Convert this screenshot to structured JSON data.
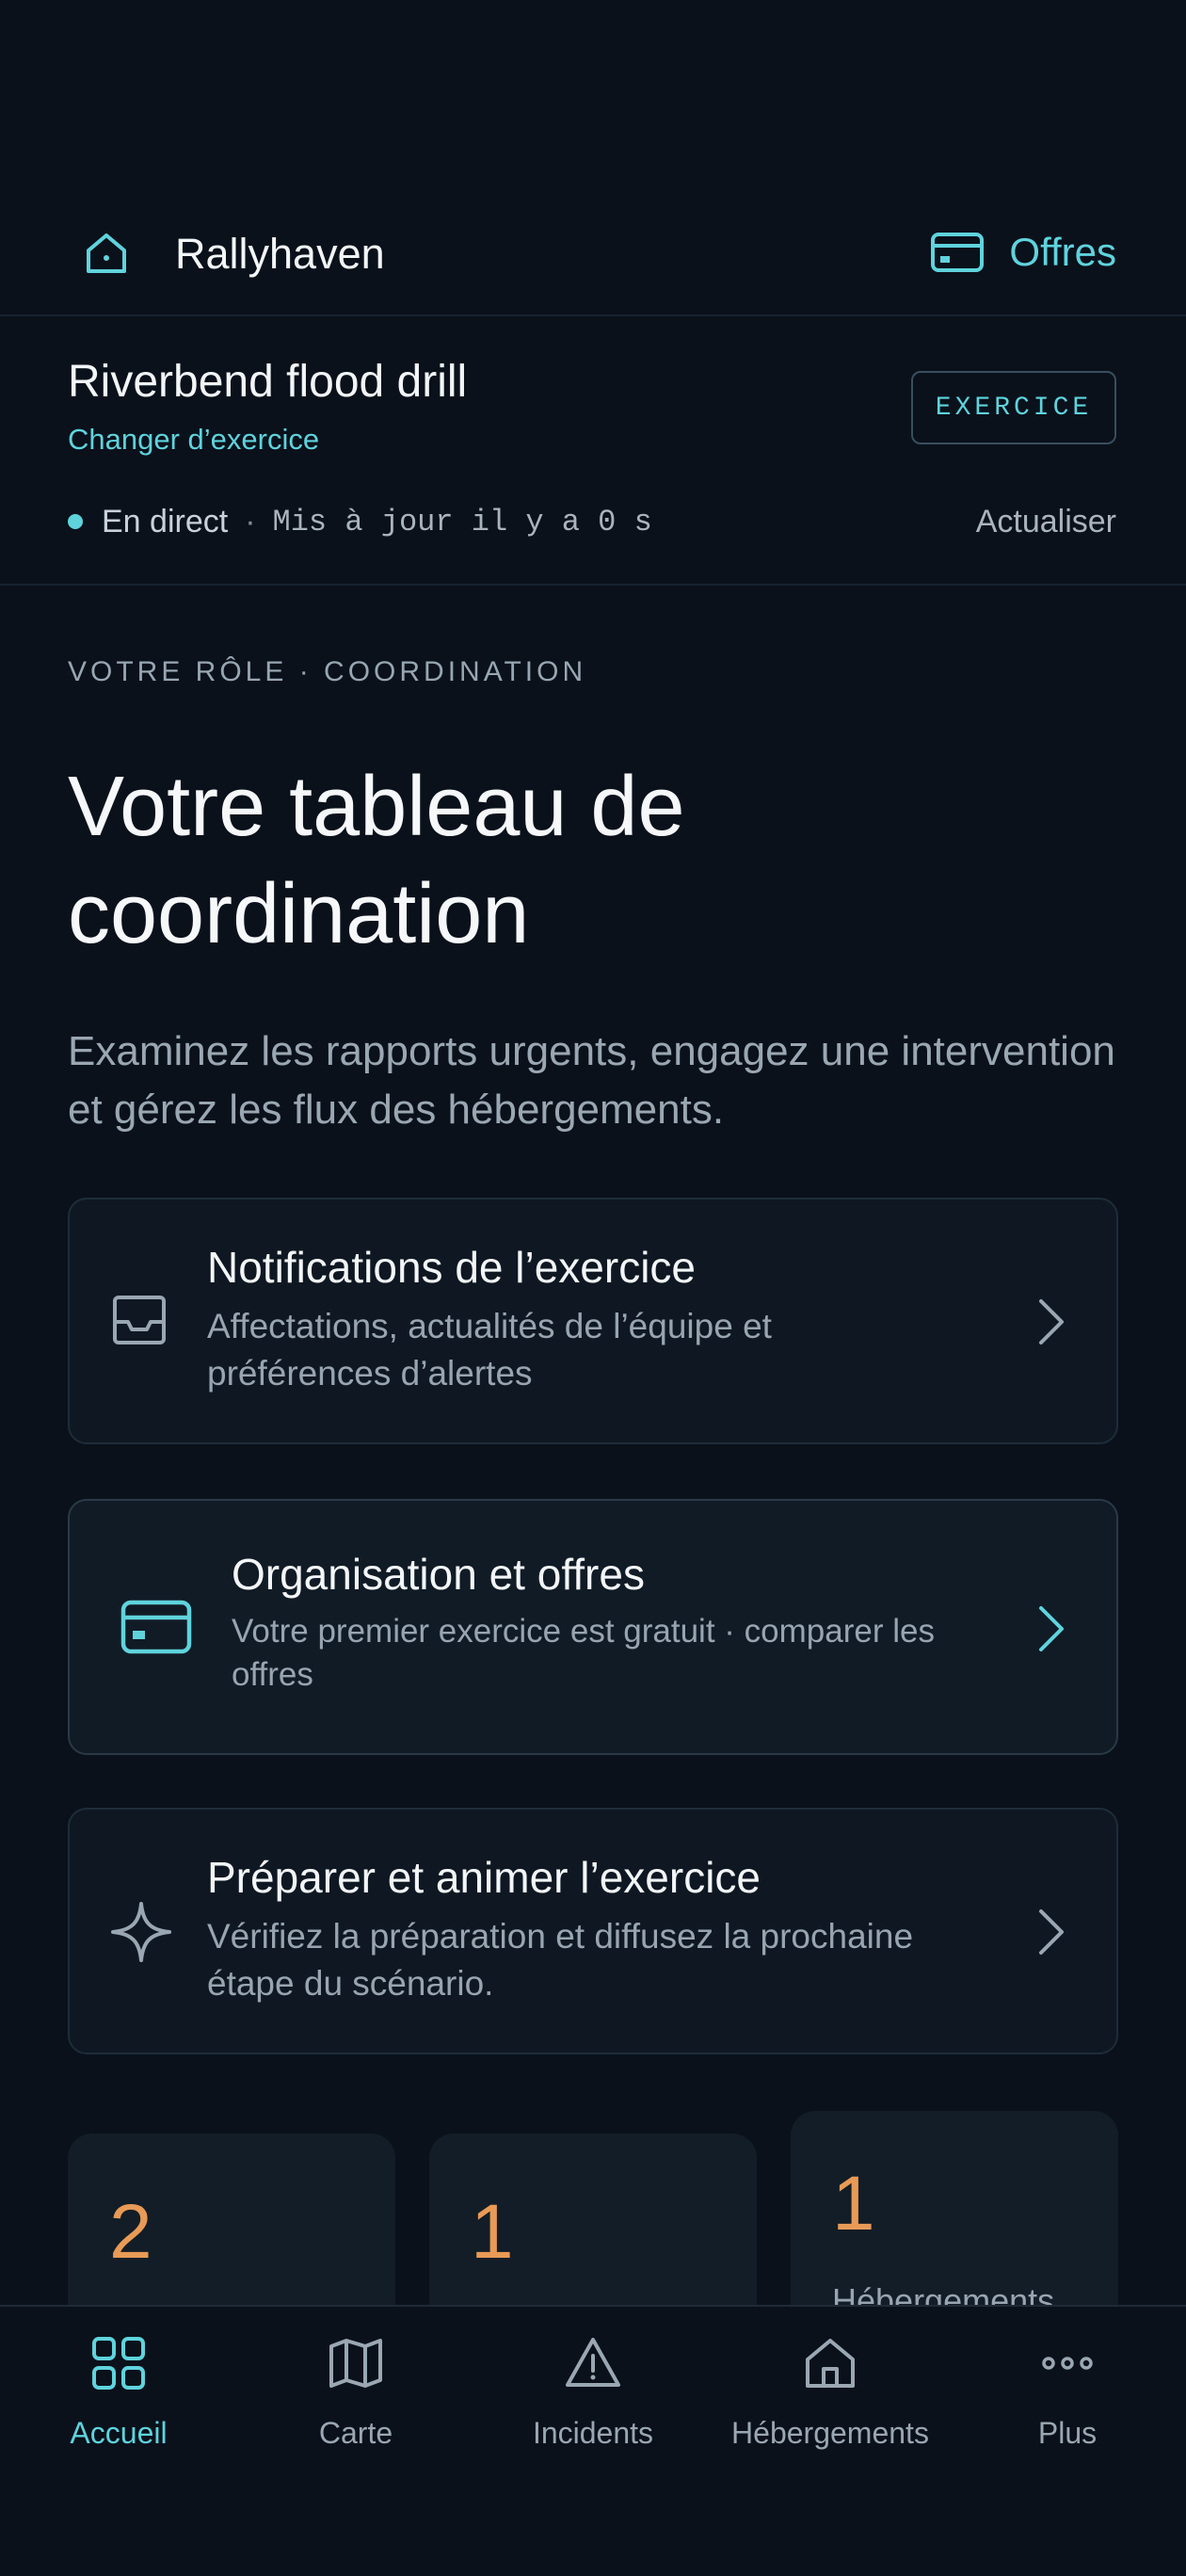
{
  "header": {
    "app_name": "Rallyhaven",
    "offers_label": "Offres",
    "home_icon": "home-icon",
    "offers_icon": "credit-card-icon"
  },
  "exercise": {
    "title": "Riverbend flood drill",
    "change_label": "Changer d’exercice",
    "mode_badge": "EXERCICE",
    "live_label": "En direct",
    "separator": "·",
    "updated_text": "Mis à jour il y a 0 s",
    "refresh_label": "Actualiser"
  },
  "main": {
    "role_label": "VOTRE RÔLE · COORDINATION",
    "title": "Votre tableau de coordination",
    "subtitle": "Examinez les rapports urgents, engagez une intervention et gérez les flux des hébergements.",
    "cards": [
      {
        "title": "Notifications de l’exercice",
        "description": "Affectations, actualités de l’équipe et préférences d’alertes",
        "icon": "inbox-icon"
      },
      {
        "title": "Organisation et offres",
        "description": "Votre premier exercice est gratuit · comparer les offres",
        "icon": "credit-card-icon"
      },
      {
        "title": "Préparer et animer l’exercice",
        "description": "Vérifiez la préparation et diffusez la prochaine étape du scénario.",
        "icon": "sparkle-icon"
      }
    ],
    "stats": [
      {
        "value": "2",
        "label": ""
      },
      {
        "value": "1",
        "label": ""
      },
      {
        "value": "1",
        "label": "Hébergements"
      }
    ]
  },
  "bottom_nav": {
    "items": [
      {
        "label": "Accueil",
        "icon": "grid-icon",
        "active": true
      },
      {
        "label": "Carte",
        "icon": "map-icon",
        "active": false
      },
      {
        "label": "Incidents",
        "icon": "warning-icon",
        "active": false
      },
      {
        "label": "Hébergements",
        "icon": "home-icon",
        "active": false
      },
      {
        "label": "Plus",
        "icon": "more-icon",
        "active": false
      }
    ]
  },
  "colors": {
    "background": "#0a111b",
    "accent": "#5fd3dc",
    "stat_value": "#e89a56",
    "card_background": "#0f1822"
  }
}
